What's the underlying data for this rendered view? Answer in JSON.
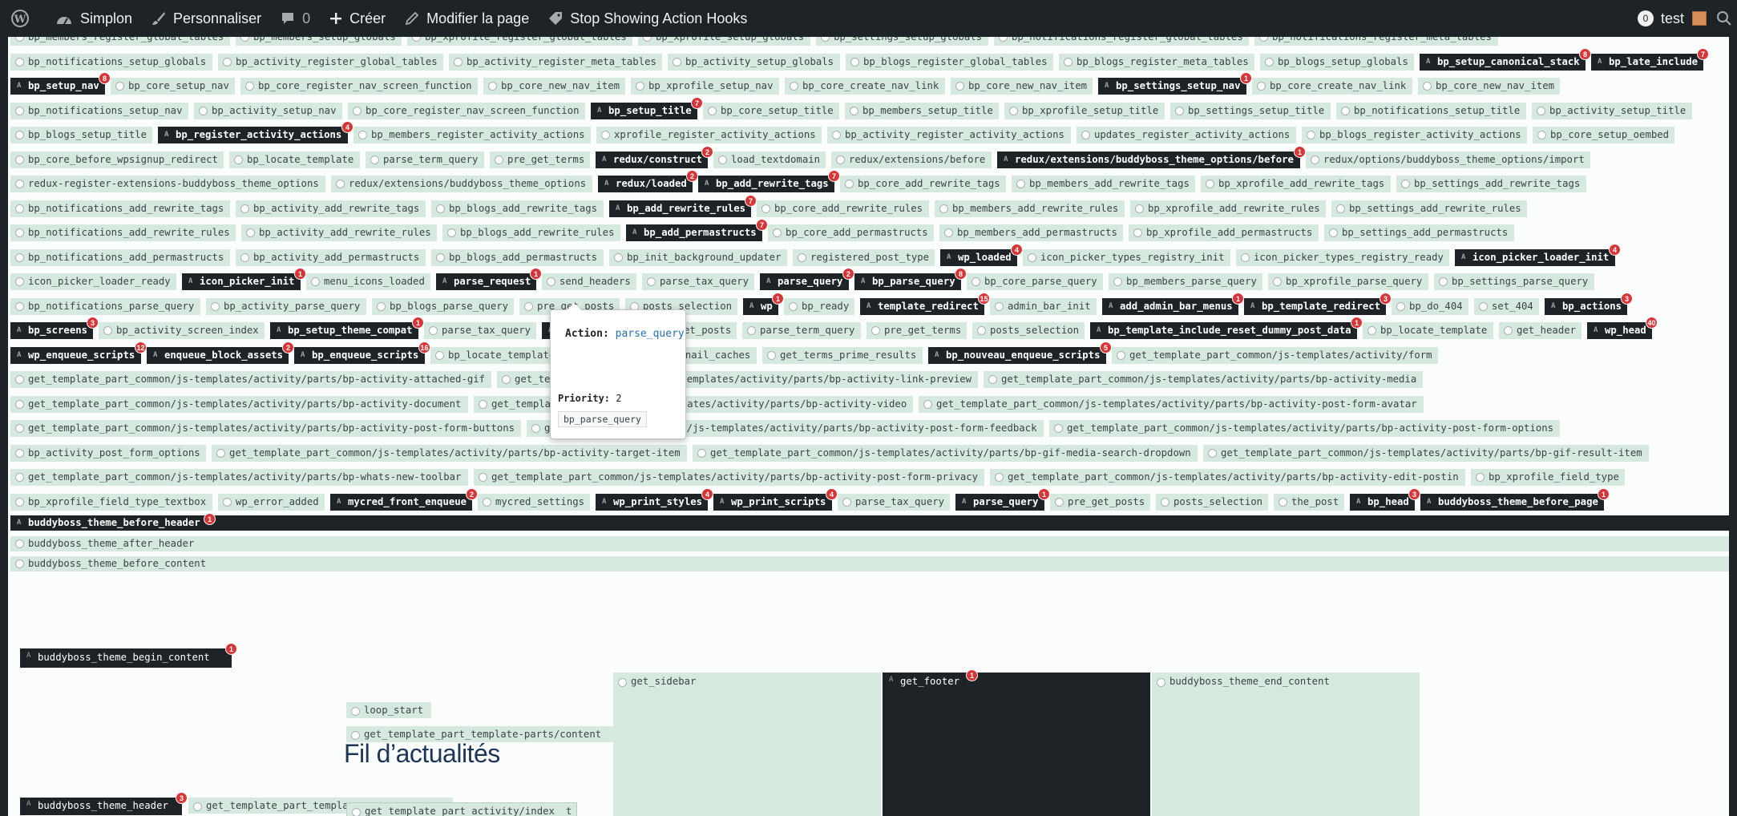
{
  "adminbar": {
    "site_name": "Simplon",
    "customize": "Personnaliser",
    "comments_count": "0",
    "new": "Créer",
    "edit_page": "Modifier la page",
    "stop_hooks": "Stop Showing Action Hooks",
    "notif_count": "0",
    "user": "test"
  },
  "rows": [
    {
      "items": [
        {
          "l": "bp_members_register_global_tables"
        },
        {
          "l": "bp_members_setup_globals"
        },
        {
          "l": "bp_xprofile_register_global_tables"
        },
        {
          "l": "bp_xprofile_setup_globals"
        },
        {
          "l": "bp_settings_setup_globals"
        },
        {
          "l": "bp_notifications_register_global_tables"
        },
        {
          "l": "bp_notifications_register_meta_tables"
        }
      ]
    },
    {
      "items": [
        {
          "l": "bp_notifications_setup_globals"
        },
        {
          "l": "bp_activity_register_global_tables"
        },
        {
          "l": "bp_activity_register_meta_tables"
        },
        {
          "l": "bp_activity_setup_globals"
        },
        {
          "l": "bp_blogs_register_global_tables"
        },
        {
          "l": "bp_blogs_register_meta_tables"
        },
        {
          "l": "bp_blogs_setup_globals"
        },
        {
          "l": "bp_setup_canonical_stack",
          "d": 1,
          "b": "8"
        },
        {
          "l": "bp_late_include",
          "d": 1,
          "b": "7"
        }
      ]
    },
    {
      "items": [
        {
          "l": "bp_setup_nav",
          "d": 1,
          "b": "8"
        },
        {
          "l": "bp_core_setup_nav"
        },
        {
          "l": "bp_core_register_nav_screen_function"
        },
        {
          "l": "bp_core_new_nav_item"
        },
        {
          "l": "bp_xprofile_setup_nav"
        },
        {
          "l": "bp_core_create_nav_link"
        },
        {
          "l": "bp_core_new_nav_item"
        },
        {
          "l": "bp_settings_setup_nav",
          "d": 1,
          "b": "1"
        },
        {
          "l": "bp_core_create_nav_link"
        },
        {
          "l": "bp_core_new_nav_item"
        }
      ]
    },
    {
      "items": [
        {
          "l": "bp_notifications_setup_nav"
        },
        {
          "l": "bp_activity_setup_nav"
        },
        {
          "l": "bp_core_register_nav_screen_function"
        },
        {
          "l": "bp_setup_title",
          "d": 1,
          "b": "7"
        },
        {
          "l": "bp_core_setup_title"
        },
        {
          "l": "bp_members_setup_title"
        },
        {
          "l": "bp_xprofile_setup_title"
        },
        {
          "l": "bp_settings_setup_title"
        },
        {
          "l": "bp_notifications_setup_title"
        },
        {
          "l": "bp_activity_setup_title"
        }
      ]
    },
    {
      "items": [
        {
          "l": "bp_blogs_setup_title"
        },
        {
          "l": "bp_register_activity_actions",
          "d": 1,
          "b": "4"
        },
        {
          "l": "bp_members_register_activity_actions"
        },
        {
          "l": "xprofile_register_activity_actions"
        },
        {
          "l": "bp_activity_register_activity_actions"
        },
        {
          "l": "updates_register_activity_actions"
        },
        {
          "l": "bp_blogs_register_activity_actions"
        },
        {
          "l": "bp_core_setup_oembed"
        }
      ]
    },
    {
      "items": [
        {
          "l": "bp_core_before_wpsignup_redirect"
        },
        {
          "l": "bp_locate_template"
        },
        {
          "l": "parse_term_query"
        },
        {
          "l": "pre_get_terms"
        },
        {
          "l": "redux/construct",
          "d": 1,
          "b": "2"
        },
        {
          "l": "load_textdomain"
        },
        {
          "l": "redux/extensions/before"
        },
        {
          "l": "redux/extensions/buddyboss_theme_options/before",
          "d": 1,
          "b": "1"
        },
        {
          "l": "redux/options/buddyboss_theme_options/import"
        }
      ]
    },
    {
      "items": [
        {
          "l": "redux-register-extensions-buddyboss_theme_options"
        },
        {
          "l": "redux/extensions/buddyboss_theme_options"
        },
        {
          "l": "redux/loaded",
          "d": 1,
          "b": "2"
        },
        {
          "l": "bp_add_rewrite_tags",
          "d": 1,
          "b": "7"
        },
        {
          "l": "bp_core_add_rewrite_tags"
        },
        {
          "l": "bp_members_add_rewrite_tags"
        },
        {
          "l": "bp_xprofile_add_rewrite_tags"
        },
        {
          "l": "bp_settings_add_rewrite_tags"
        }
      ]
    },
    {
      "items": [
        {
          "l": "bp_notifications_add_rewrite_tags"
        },
        {
          "l": "bp_activity_add_rewrite_tags"
        },
        {
          "l": "bp_blogs_add_rewrite_tags"
        },
        {
          "l": "bp_add_rewrite_rules",
          "d": 1,
          "b": "7"
        },
        {
          "l": "bp_core_add_rewrite_rules"
        },
        {
          "l": "bp_members_add_rewrite_rules"
        },
        {
          "l": "bp_xprofile_add_rewrite_rules"
        },
        {
          "l": "bp_settings_add_rewrite_rules"
        }
      ]
    },
    {
      "items": [
        {
          "l": "bp_notifications_add_rewrite_rules"
        },
        {
          "l": "bp_activity_add_rewrite_rules"
        },
        {
          "l": "bp_blogs_add_rewrite_rules"
        },
        {
          "l": "bp_add_permastructs",
          "d": 1,
          "b": "7"
        },
        {
          "l": "bp_core_add_permastructs"
        },
        {
          "l": "bp_members_add_permastructs"
        },
        {
          "l": "bp_xprofile_add_permastructs"
        },
        {
          "l": "bp_settings_add_permastructs"
        }
      ]
    },
    {
      "items": [
        {
          "l": "bp_notifications_add_permastructs"
        },
        {
          "l": "bp_activity_add_permastructs"
        },
        {
          "l": "bp_blogs_add_permastructs"
        },
        {
          "l": "bp_init_background_updater"
        },
        {
          "l": "registered_post_type"
        },
        {
          "l": "wp_loaded",
          "d": 1,
          "b": "4"
        },
        {
          "l": "icon_picker_types_registry_init"
        },
        {
          "l": "icon_picker_types_registry_ready"
        },
        {
          "l": "icon_picker_loader_init",
          "d": 1,
          "b": "4"
        }
      ]
    },
    {
      "items": [
        {
          "l": "icon_picker_loader_ready"
        },
        {
          "l": "icon_picker_init",
          "d": 1,
          "b": "1"
        },
        {
          "l": "menu_icons_loaded"
        },
        {
          "l": "parse_request",
          "d": 1,
          "b": "1"
        },
        {
          "l": "send_headers"
        },
        {
          "l": "parse_tax_query"
        },
        {
          "l": "parse_query",
          "d": 1,
          "b": "2"
        },
        {
          "l": "bp_parse_query",
          "d": 1,
          "b": "8"
        },
        {
          "l": "bp_core_parse_query"
        },
        {
          "l": "bp_members_parse_query"
        },
        {
          "l": "bp_xprofile_parse_query"
        },
        {
          "l": "bp_settings_parse_query"
        }
      ]
    },
    {
      "items": [
        {
          "l": "bp_notifications_parse_query"
        },
        {
          "l": "bp_activity_parse_query"
        },
        {
          "l": "bp_blogs_parse_query"
        },
        {
          "l": "pre_get_posts"
        },
        {
          "l": "posts_selection"
        },
        {
          "l": "wp",
          "d": 1,
          "b": "1"
        },
        {
          "l": "bp_ready"
        },
        {
          "l": "template_redirect",
          "d": 1,
          "b": "15"
        },
        {
          "l": "admin_bar_init"
        },
        {
          "l": "add_admin_bar_menus",
          "d": 1,
          "b": "1"
        },
        {
          "l": "bp_template_redirect",
          "d": 1,
          "b": "3"
        },
        {
          "l": "bp_do_404"
        },
        {
          "l": "set_404"
        },
        {
          "l": "bp_actions",
          "d": 1,
          "b": "3"
        }
      ]
    },
    {
      "items": [
        {
          "l": "bp_screens",
          "d": 1,
          "b": "3"
        },
        {
          "l": "bp_activity_screen_index"
        },
        {
          "l": "bp_setup_theme_compat",
          "d": 1,
          "b": "1"
        },
        {
          "l": "parse_tax_query"
        },
        {
          "l": "parse_query",
          "d": 1,
          "b": "2"
        },
        {
          "l": "pre_get_posts"
        },
        {
          "l": "parse_term_query"
        },
        {
          "l": "pre_get_terms"
        },
        {
          "l": "posts_selection"
        },
        {
          "l": "bp_template_include_reset_dummy_post_data",
          "d": 1,
          "b": "1"
        },
        {
          "l": "bp_locate_template"
        },
        {
          "l": "get_header"
        },
        {
          "l": "wp_head",
          "d": 1,
          "b": "40"
        }
      ]
    },
    {
      "items": [
        {
          "l": "wp_enqueue_scripts",
          "d": 1,
          "b": "12"
        },
        {
          "l": "enqueue_block_assets",
          "d": 1,
          "b": "2"
        },
        {
          "l": "bp_enqueue_scripts",
          "d": 1,
          "b": "16"
        },
        {
          "l": "bp_locate_template"
        },
        {
          "l": "update_post_thumbnail_caches"
        },
        {
          "l": "get_terms_prime_results"
        },
        {
          "l": "bp_nouveau_enqueue_scripts",
          "d": 1,
          "b": "5"
        },
        {
          "l": "get_template_part_common/js-templates/activity/form"
        }
      ]
    },
    {
      "items": [
        {
          "l": "get_template_part_common/js-templates/activity/parts/bp-activity-attached-gif"
        },
        {
          "l": "get_template_part_common/js-templates/activity/parts/bp-activity-link-preview"
        },
        {
          "l": "get_template_part_common/js-templates/activity/parts/bp-activity-media"
        }
      ]
    },
    {
      "items": [
        {
          "l": "get_template_part_common/js-templates/activity/parts/bp-activity-document"
        },
        {
          "l": "get_template_part_common/js-templates/activity/parts/bp-activity-video"
        },
        {
          "l": "get_template_part_common/js-templates/activity/parts/bp-activity-post-form-avatar"
        }
      ]
    },
    {
      "items": [
        {
          "l": "get_template_part_common/js-templates/activity/parts/bp-activity-post-form-buttons"
        },
        {
          "l": "get_template_part_common/js-templates/activity/parts/bp-activity-post-form-feedback"
        },
        {
          "l": "get_template_part_common/js-templates/activity/parts/bp-activity-post-form-options"
        }
      ]
    },
    {
      "items": [
        {
          "l": "bp_activity_post_form_options"
        },
        {
          "l": "get_template_part_common/js-templates/activity/parts/bp-activity-target-item"
        },
        {
          "l": "get_template_part_common/js-templates/activity/parts/bp-gif-media-search-dropdown"
        },
        {
          "l": "get_template_part_common/js-templates/activity/parts/bp-gif-result-item"
        }
      ]
    },
    {
      "items": [
        {
          "l": "get_template_part_common/js-templates/activity/parts/bp-whats-new-toolbar"
        },
        {
          "l": "get_template_part_common/js-templates/activity/parts/bp-activity-post-form-privacy"
        },
        {
          "l": "get_template_part_common/js-templates/activity/parts/bp-activity-edit-postin"
        },
        {
          "l": "bp_xprofile_field_type"
        }
      ]
    },
    {
      "items": [
        {
          "l": "bp_xprofile_field_type_textbox"
        },
        {
          "l": "wp_error_added"
        },
        {
          "l": "mycred_front_enqueue",
          "d": 1,
          "b": "2"
        },
        {
          "l": "mycred_settings"
        },
        {
          "l": "wp_print_styles",
          "d": 1,
          "b": "4"
        },
        {
          "l": "wp_print_scripts",
          "d": 1,
          "b": "4"
        },
        {
          "l": "parse_tax_query"
        },
        {
          "l": "parse_query",
          "d": 1,
          "b": "1"
        },
        {
          "l": "pre_get_posts"
        },
        {
          "l": "posts_selection"
        },
        {
          "l": "the_post"
        },
        {
          "l": "bp_head",
          "d": 1,
          "b": "3"
        },
        {
          "l": "buddyboss_theme_before_page",
          "d": 1,
          "b": "1"
        }
      ]
    }
  ],
  "full_rows": [
    {
      "l": "buddyboss_theme_before_header",
      "d": 1,
      "b": "1"
    },
    {
      "l": "buddyboss_theme_after_header"
    },
    {
      "l": "buddyboss_theme_before_content"
    }
  ],
  "tooltip": {
    "action_label": "Action:",
    "action_value": "parse_query",
    "priority_label": "Priority:",
    "priority_value": "2",
    "callback": "bp_parse_query"
  },
  "lower": {
    "begin_content": "buddyboss_theme_begin_content",
    "begin_content_badge": "1",
    "get_sidebar": "get_sidebar",
    "get_footer": "get_footer",
    "get_footer_badge": "1",
    "end_content": "buddyboss_theme_end_content",
    "loop_start": "loop_start",
    "template_part_content": "get_template_part_template-parts/content",
    "page_heading": "Fil d’actualités",
    "theme_header": "buddyboss_theme_header",
    "theme_header_badge": "3",
    "template_part_partial": "get_template_part_templa",
    "activity_index": "get_template_part_activity/index",
    "activity_index_trail": "t"
  },
  "colors": {
    "tag_bg": "#d6e9de",
    "tag_dark_bg": "#1d2327",
    "badge": "#d63638",
    "adminbar": "#1d2327",
    "link": "#2271b1"
  }
}
